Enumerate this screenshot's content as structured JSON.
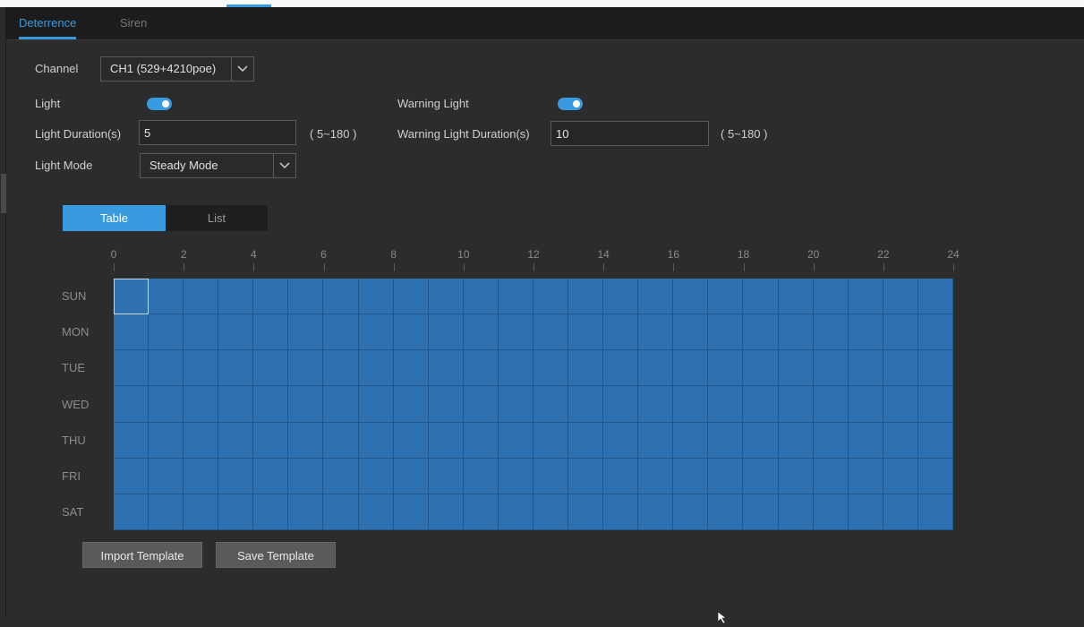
{
  "tabs": [
    {
      "label": "Deterrence",
      "active": true
    },
    {
      "label": "Siren",
      "active": false
    }
  ],
  "channel": {
    "label": "Channel",
    "value": "CH1 (529+4210poe)"
  },
  "light": {
    "label": "Light",
    "on": true
  },
  "warning_light": {
    "label": "Warning Light",
    "on": true
  },
  "light_duration": {
    "label": "Light Duration(s)",
    "value": "5",
    "range": "( 5~180 )"
  },
  "warning_light_duration": {
    "label": "Warning Light Duration(s)",
    "value": "10",
    "range": "( 5~180 )"
  },
  "light_mode": {
    "label": "Light Mode",
    "value": "Steady Mode"
  },
  "view_toggle": {
    "table": "Table",
    "list": "List",
    "active": "Table"
  },
  "schedule": {
    "hour_labels": [
      "0",
      "2",
      "4",
      "6",
      "8",
      "10",
      "12",
      "14",
      "16",
      "18",
      "20",
      "22",
      "24"
    ],
    "days": [
      "SUN",
      "MON",
      "TUE",
      "WED",
      "THU",
      "FRI",
      "SAT"
    ],
    "all_hours_enabled": true,
    "cell_color": "#2f71b0"
  },
  "buttons": {
    "import": "Import Template",
    "save": "Save Template"
  },
  "colors": {
    "accent": "#3a9ae0",
    "background": "#2c2c2c",
    "header": "#1c1c1c"
  }
}
